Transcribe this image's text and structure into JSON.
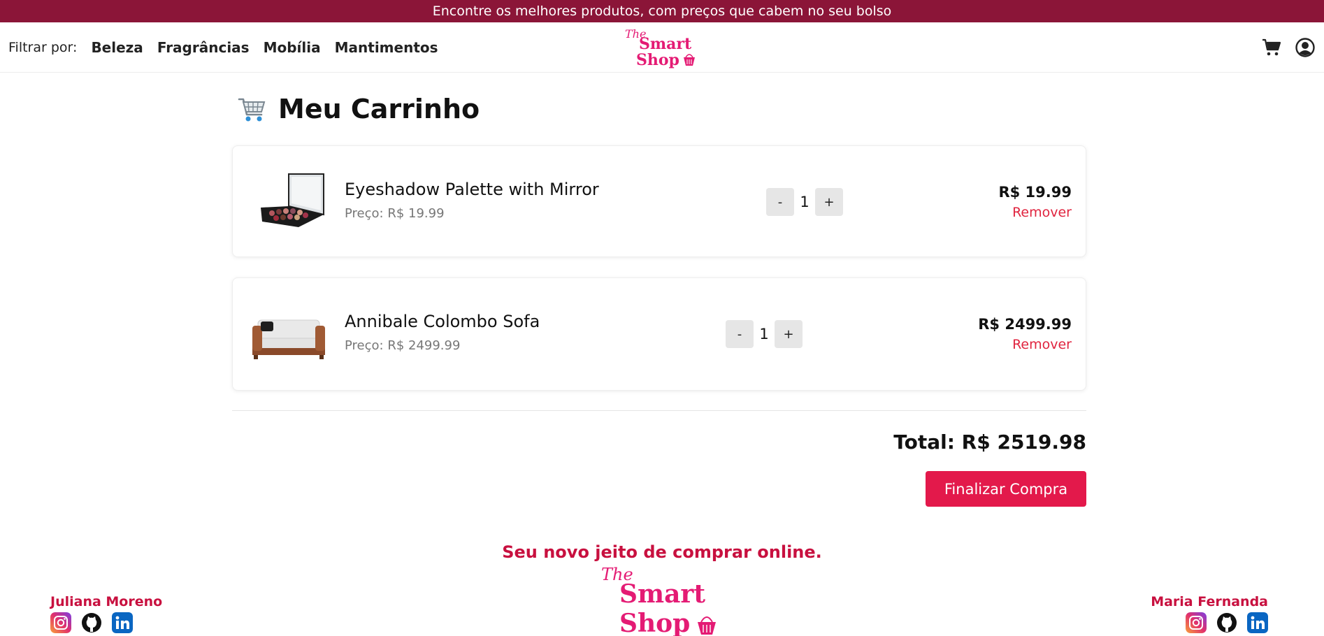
{
  "banner": {
    "text": "Encontre os melhores produtos, com preços que cabem no seu bolso"
  },
  "nav": {
    "filter_label": "Filtrar por:",
    "categories": [
      "Beleza",
      "Fragrâncias",
      "Mobília",
      "Mantimentos"
    ],
    "logo": {
      "the": "The",
      "line1": "Smart",
      "line2": "Shop"
    },
    "icons": [
      "cart-icon",
      "user-account-icon"
    ]
  },
  "cart": {
    "title": "Meu Carrinho",
    "title_icon": "shopping-cart-icon",
    "items": [
      {
        "name": "Eyeshadow Palette with Mirror",
        "unit_price": "Preço: R$ 19.99",
        "quantity": "1",
        "decrement": "-",
        "increment": "+",
        "line_total": "R$ 19.99",
        "remove": "Remover",
        "image": "eyeshadow-palette-image"
      },
      {
        "name": "Annibale Colombo Sofa",
        "unit_price": "Preço: R$ 2499.99",
        "quantity": "1",
        "decrement": "-",
        "increment": "+",
        "line_total": "R$ 2499.99",
        "remove": "Remover",
        "image": "sofa-image"
      }
    ],
    "total": "Total: R$ 2519.98",
    "checkout": "Finalizar Compra"
  },
  "footer": {
    "slogan": "Seu novo jeito de comprar online.",
    "logo": {
      "the": "The",
      "line1": "Smart",
      "line2": "Shop"
    },
    "authors": [
      {
        "name": "Juliana Moreno",
        "socials": [
          "instagram-icon",
          "github-icon",
          "linkedin-icon"
        ]
      },
      {
        "name": "Maria Fernanda",
        "socials": [
          "instagram-icon",
          "github-icon",
          "linkedin-icon"
        ]
      }
    ]
  },
  "colors": {
    "banner_bg": "#8b1538",
    "brand_pink": "#e41b74",
    "checkout_red": "#e3194b",
    "remove_red": "#e0243f",
    "footer_text": "#c8103f"
  }
}
